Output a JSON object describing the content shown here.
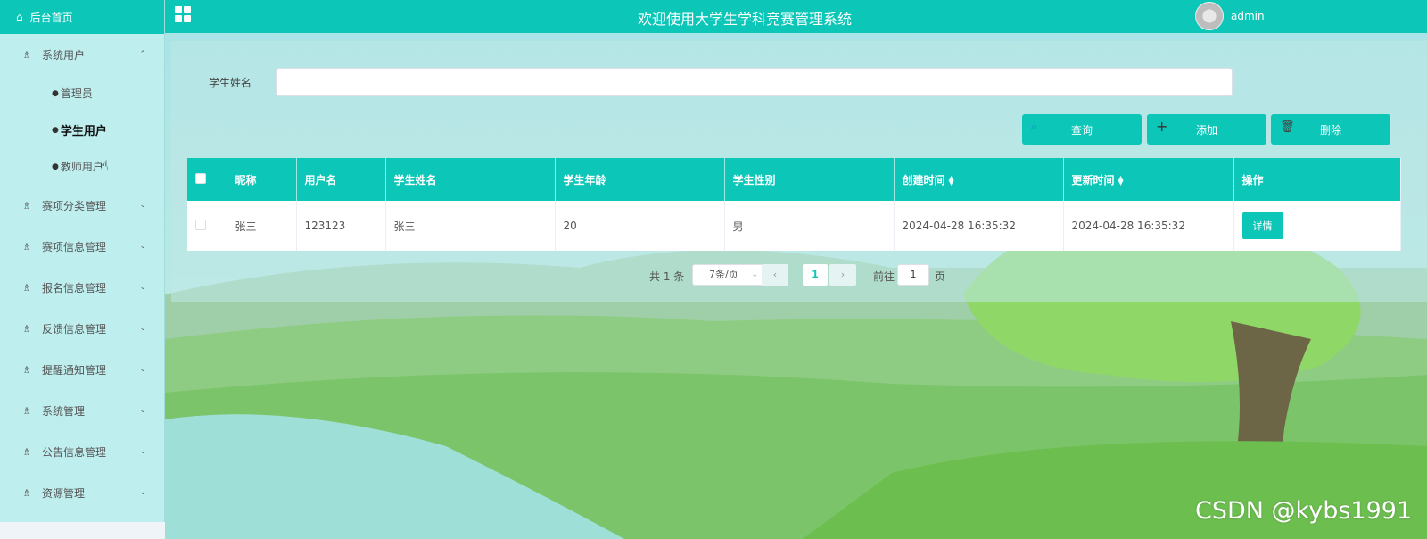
{
  "header": {
    "title": "欢迎使用大学生学科竞赛管理系统",
    "username": "admin"
  },
  "sidebar": {
    "home": "后台首页",
    "groups": [
      {
        "label": "系统用户",
        "open": true,
        "children": [
          {
            "label": "管理员"
          },
          {
            "label": "学生用户",
            "active": true
          },
          {
            "label": "教师用户"
          }
        ]
      },
      {
        "label": "赛项分类管理"
      },
      {
        "label": "赛项信息管理"
      },
      {
        "label": "报名信息管理"
      },
      {
        "label": "反馈信息管理"
      },
      {
        "label": "提醒通知管理"
      },
      {
        "label": "系统管理"
      },
      {
        "label": "公告信息管理"
      },
      {
        "label": "资源管理"
      }
    ]
  },
  "search": {
    "label": "学生姓名",
    "value": ""
  },
  "buttons": {
    "query": "查询",
    "add": "添加",
    "delete": "删除"
  },
  "table": {
    "headers": [
      "",
      "昵称",
      "用户名",
      "学生姓名",
      "学生年龄",
      "学生性别",
      "创建时间",
      "更新时间",
      "操作"
    ],
    "rows": [
      [
        "",
        "张三",
        "123123",
        "张三",
        "20",
        "男",
        "2024-04-28 16:35:32",
        "2024-04-28 16:35:32",
        "详情"
      ]
    ]
  },
  "pagination": {
    "total": "共 1 条",
    "page_size": "7条/页",
    "current": "1",
    "goto_label": "前往",
    "goto_value": "1",
    "page_unit": "页"
  },
  "watermark": "CSDN @kybs1991",
  "colors": {
    "accent": "#0cc6b8",
    "sidebar": "#bfeeee"
  }
}
